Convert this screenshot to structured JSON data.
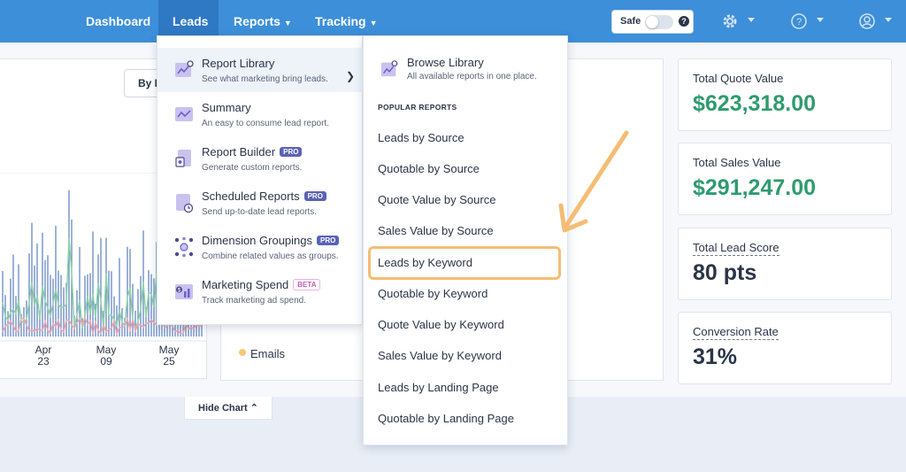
{
  "nav": {
    "items": [
      {
        "label": "Dashboard",
        "active": false
      },
      {
        "label": "Leads",
        "active": true
      },
      {
        "label": "Reports",
        "active": false,
        "dropdown": true
      },
      {
        "label": "Tracking",
        "active": false,
        "dropdown": true
      }
    ],
    "safe_label": "Safe",
    "safe_help": "?",
    "icons": [
      "gear-icon",
      "help-icon",
      "user-icon"
    ],
    "color": "#3c8fd8"
  },
  "chart_controls": {
    "group_button_label": "By D",
    "hide_chart_label": "Hide Chart"
  },
  "chart_data": {
    "type": "line",
    "x_ticks": [
      {
        "month": "Apr",
        "day": "23"
      },
      {
        "month": "May",
        "day": "09"
      },
      {
        "month": "May",
        "day": "25"
      }
    ],
    "legend": [
      "Emails"
    ]
  },
  "stats": [
    {
      "label": "Total Quote Value",
      "value": "$623,318.00",
      "color": "#2f9b6e"
    },
    {
      "label": "Total Sales Value",
      "value": "$291,247.00",
      "color": "#2f9b6e"
    },
    {
      "label": "Total Lead Score",
      "value": "80 pts",
      "color": "#2b3549"
    },
    {
      "label": "Conversion Rate",
      "value": "31%",
      "color": "#2b3549"
    }
  ],
  "reports_menu": {
    "items": [
      {
        "title": "Report Library",
        "desc": "See what marketing bring leads.",
        "badge": "",
        "icon": "report-library-icon"
      },
      {
        "title": "Summary",
        "desc": "An easy to consume lead report.",
        "badge": "",
        "icon": "summary-icon"
      },
      {
        "title": "Report Builder",
        "desc": "Generate custom reports.",
        "badge": "PRO",
        "icon": "report-builder-icon"
      },
      {
        "title": "Scheduled Reports",
        "desc": "Send up-to-date lead reports.",
        "badge": "PRO",
        "icon": "scheduled-reports-icon"
      },
      {
        "title": "Dimension Groupings",
        "desc": "Combine related values as groups.",
        "badge": "PRO",
        "icon": "dimension-groupings-icon"
      },
      {
        "title": "Marketing Spend",
        "desc": "Track marketing ad spend.",
        "badge": "BETA",
        "icon": "marketing-spend-icon"
      }
    ]
  },
  "library_menu": {
    "browse_title": "Browse Library",
    "browse_desc": "All available reports in one place.",
    "popular_heading": "POPULAR REPORTS",
    "reports": [
      "Leads by Source",
      "Quotable by Source",
      "Quote Value by Source",
      "Sales Value by Source",
      "Leads by Keyword",
      "Quotable by Keyword",
      "Quote Value by Keyword",
      "Sales Value by Keyword",
      "Leads by Landing Page",
      "Quotable by Landing Page"
    ],
    "highlighted": "Leads by Keyword",
    "highlight_color": "#f4bd74"
  }
}
